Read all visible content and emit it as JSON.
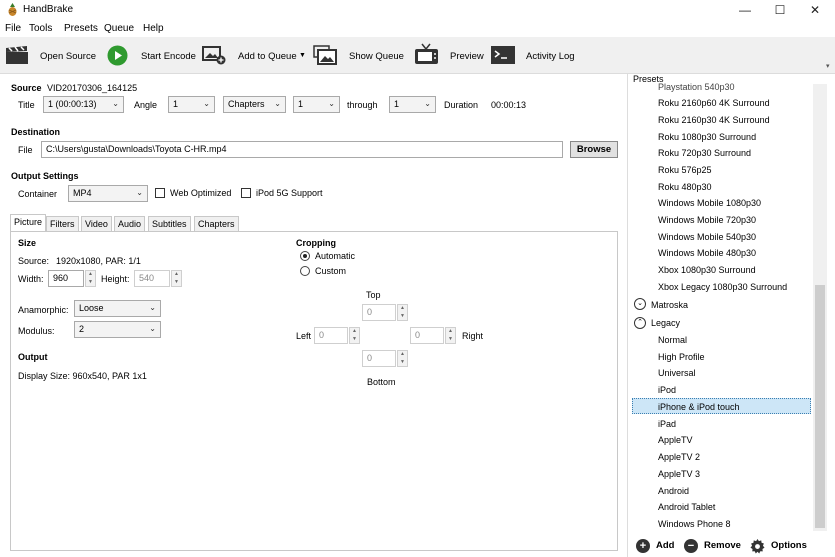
{
  "app": {
    "title": "HandBrake"
  },
  "window_controls": {
    "minimize": "—",
    "maximize": "☐",
    "close": "✕"
  },
  "menu": [
    "File",
    "Tools",
    "Presets",
    "Queue",
    "Help"
  ],
  "toolbar": {
    "open_source": "Open Source",
    "start_encode": "Start Encode",
    "add_to_queue": "Add to Queue",
    "show_queue": "Show Queue",
    "preview": "Preview",
    "activity_log": "Activity Log"
  },
  "source": {
    "label": "Source",
    "name": "VID20170306_164125",
    "title_label": "Title",
    "title_value": "1 (00:00:13)",
    "angle_label": "Angle",
    "angle_value": "1",
    "range_mode": "Chapters",
    "range_start": "1",
    "through_label": "through",
    "range_end": "1",
    "duration_label": "Duration",
    "duration_value": "00:00:13"
  },
  "destination": {
    "label": "Destination",
    "file_label": "File",
    "file_value": "C:\\Users\\gusta\\Downloads\\Toyota C-HR.mp4",
    "browse_label": "Browse"
  },
  "output_settings": {
    "label": "Output Settings",
    "container_label": "Container",
    "container_value": "MP4",
    "web_optimized": "Web Optimized",
    "web_optimized_checked": false,
    "ipod_support": "iPod 5G Support",
    "ipod_support_checked": false
  },
  "tabs": [
    "Picture",
    "Filters",
    "Video",
    "Audio",
    "Subtitles",
    "Chapters"
  ],
  "active_tab": "Picture",
  "picture": {
    "size_label": "Size",
    "source_label": "Source:",
    "source_value": "1920x1080, PAR: 1/1",
    "width_label": "Width:",
    "width_value": "960",
    "height_label": "Height:",
    "height_value": "540",
    "anamorphic_label": "Anamorphic:",
    "anamorphic_value": "Loose",
    "modulus_label": "Modulus:",
    "modulus_value": "2",
    "output_label": "Output",
    "display_size": "Display Size: 960x540,  PAR 1x1",
    "cropping_label": "Cropping",
    "automatic": "Automatic",
    "custom": "Custom",
    "selected_crop": "Automatic",
    "top_label": "Top",
    "top_value": "0",
    "left_label": "Left",
    "left_value": "0",
    "right_label": "Right",
    "right_value": "0",
    "bottom_label": "Bottom",
    "bottom_value": "0"
  },
  "presets": {
    "header": "Presets",
    "items_top": [
      "Playstation 540p30",
      "Roku 2160p60 4K Surround",
      "Roku 2160p30 4K Surround",
      "Roku 1080p30 Surround",
      "Roku 720p30 Surround",
      "Roku 576p25",
      "Roku 480p30",
      "Windows Mobile 1080p30",
      "Windows Mobile 720p30",
      "Windows Mobile 540p30",
      "Windows Mobile 480p30",
      "Xbox 1080p30 Surround",
      "Xbox Legacy 1080p30 Surround"
    ],
    "cat_matroska": "Matroska",
    "cat_legacy": "Legacy",
    "items_legacy": [
      "Normal",
      "High Profile",
      "Universal",
      "iPod",
      "iPhone & iPod touch",
      "iPad",
      "AppleTV",
      "AppleTV 2",
      "AppleTV 3",
      "Android",
      "Android Tablet",
      "Windows Phone 8"
    ],
    "selected": "iPhone & iPod touch",
    "add_label": "Add",
    "remove_label": "Remove",
    "options_label": "Options"
  }
}
